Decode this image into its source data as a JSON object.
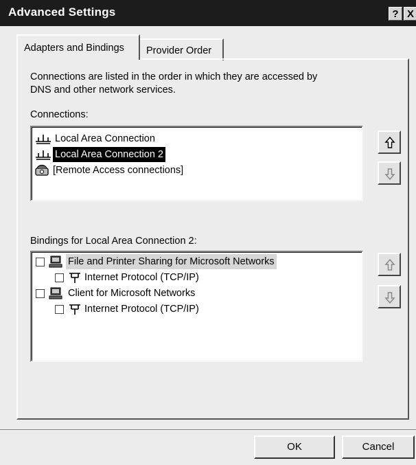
{
  "window": {
    "title": "Advanced Settings",
    "help_label": "?",
    "close_label": "X"
  },
  "tabs": [
    {
      "label": "Adapters and Bindings",
      "active": true
    },
    {
      "label": "Provider Order",
      "active": false
    }
  ],
  "description": "Connections are listed in the order in which they are accessed by DNS and other network services.",
  "description_lines": [
    "Connections are listed in the order in which they are accessed by",
    "DNS and other network services."
  ],
  "connections": {
    "label": "Connections:",
    "items": [
      {
        "label": "Local Area Connection",
        "icon": "network-icon",
        "selected": false
      },
      {
        "label": "Local Area Connection 2",
        "icon": "network-icon",
        "selected": true
      },
      {
        "label": "[Remote Access connections]",
        "icon": "phone-modem-icon",
        "selected": false
      }
    ],
    "move_up_enabled": true,
    "move_down_enabled": false
  },
  "bindings": {
    "label": "Bindings for Local Area Connection 2:",
    "items": [
      {
        "label": "File and Printer Sharing for Microsoft Networks",
        "icon": "computer-icon",
        "checked": false,
        "level": 0,
        "focused": true
      },
      {
        "label": "Internet Protocol (TCP/IP)",
        "icon": "protocol-icon",
        "checked": false,
        "level": 1,
        "focused": false
      },
      {
        "label": "Client for Microsoft Networks",
        "icon": "computer-icon",
        "checked": false,
        "level": 0,
        "focused": false
      },
      {
        "label": "Internet Protocol (TCP/IP)",
        "icon": "protocol-icon",
        "checked": false,
        "level": 1,
        "focused": false
      }
    ],
    "move_up_enabled": false,
    "move_down_enabled": false
  },
  "buttons": {
    "ok": "OK",
    "cancel": "Cancel"
  }
}
